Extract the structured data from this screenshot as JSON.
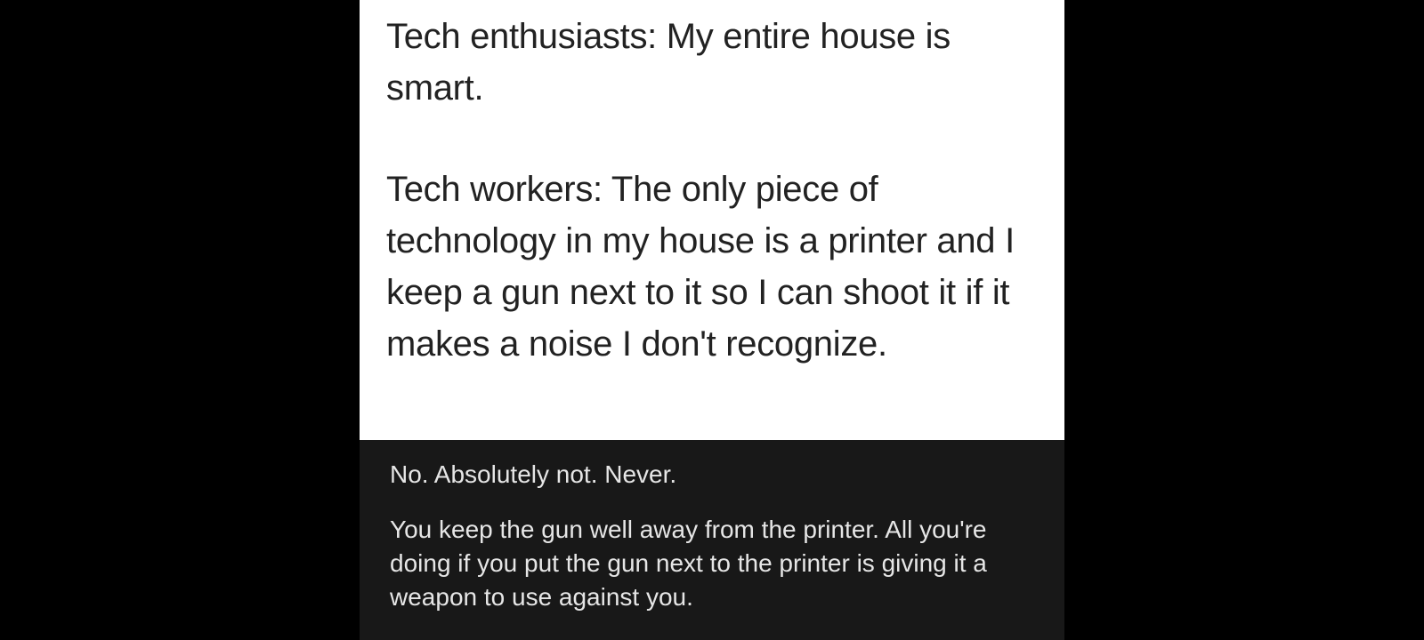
{
  "post": {
    "line1": "Tech enthusiasts: My entire house is smart.",
    "line2": "Tech workers: The only piece of technology in my house is a printer and I keep a gun next to it so I can shoot it if it makes a noise I don't recognize."
  },
  "reply": {
    "line1": "No. Absolutely not. Never.",
    "line2": "You keep the gun well away from the printer. All you're doing if you put the gun next to the printer is giving it a weapon to use against you."
  },
  "colors": {
    "background": "#000000",
    "post_background": "#ffffff",
    "reply_background": "#181818"
  }
}
